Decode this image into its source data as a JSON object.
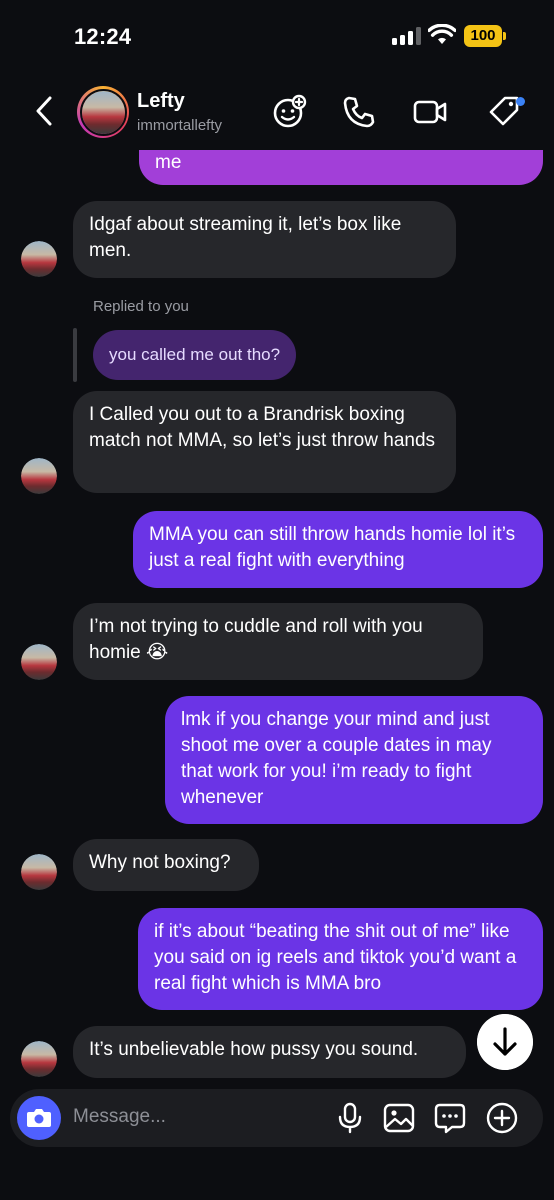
{
  "status_bar": {
    "time": "12:24",
    "battery": "100",
    "battery_color": "#f4c315"
  },
  "header": {
    "name": "Lefty",
    "handle": "immortallefty",
    "icons": [
      "back-chevron-icon",
      "sticker-effects-icon",
      "phone-icon",
      "video-camera-icon",
      "tag-icon"
    ],
    "notification_dot_color": "#3b82f6"
  },
  "messages": [
    {
      "sender": "me",
      "text": "me"
    },
    {
      "sender": "them",
      "text": "Idgaf about streaming it, let’s box like men."
    },
    {
      "sender": "them",
      "reply_label": "Replied to you",
      "reply_quote": "you called me out tho?",
      "text": "I Called you out to a Brandrisk boxing match not MMA, so let’s just throw hands"
    },
    {
      "sender": "me",
      "text": "MMA you can still throw hands homie lol it’s just a real fight with everything"
    },
    {
      "sender": "them",
      "text": "I’m not trying to cuddle and roll with you homie 😭"
    },
    {
      "sender": "me",
      "text": "lmk if you change your mind and just shoot me over a couple dates in may that work for you! i’m ready to fight whenever"
    },
    {
      "sender": "them",
      "text": "Why not boxing?"
    },
    {
      "sender": "me",
      "text": "if it’s about “beating the shit out of me” like you said on ig reels and tiktok you’d want a real fight which is MMA bro"
    },
    {
      "sender": "them",
      "text": "It’s unbelievable how pussy you sound."
    }
  ],
  "colors": {
    "outgoing_top": "#a23fd8",
    "outgoing": "#6b34e6",
    "incoming": "#26272b",
    "reply_quote": "#44256e",
    "camera_button": "#4f60ff"
  },
  "composer": {
    "placeholder": "Message...",
    "icons": [
      "camera-icon",
      "microphone-icon",
      "gallery-icon",
      "sticker-chat-icon",
      "add-icon"
    ]
  },
  "scroll_button_icon": "arrow-down-icon"
}
